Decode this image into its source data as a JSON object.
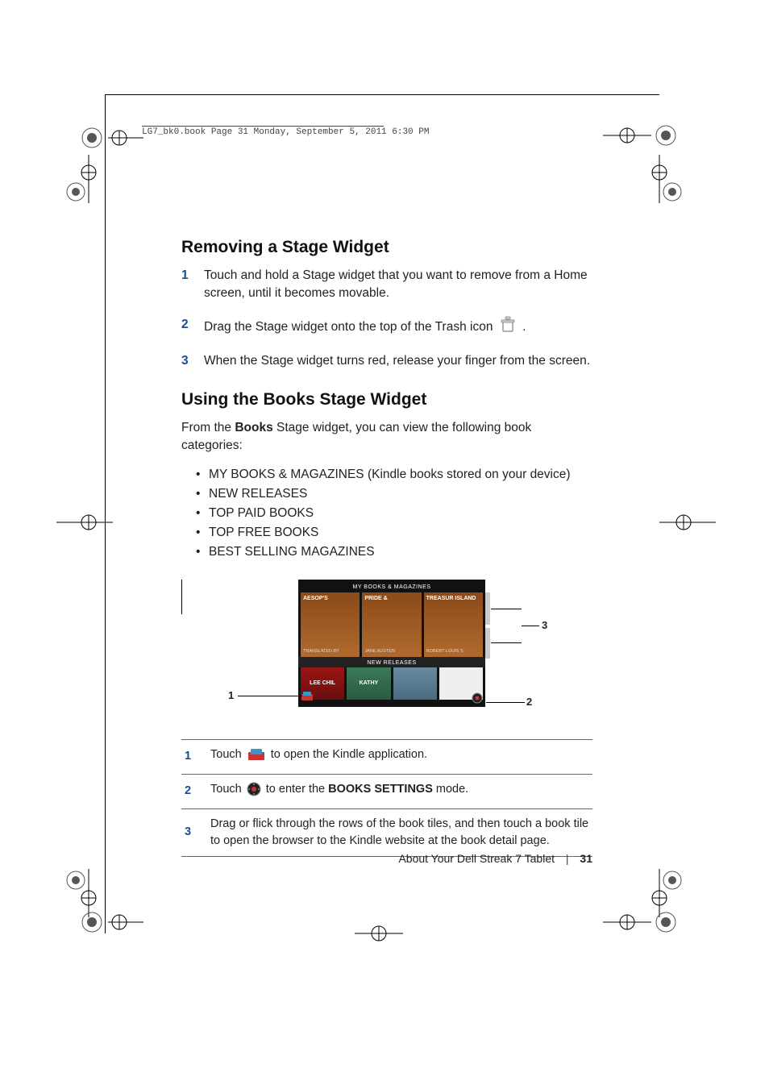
{
  "printHeader": "LG7_bk0.book  Page 31  Monday, September 5, 2011  6:30 PM",
  "section1": {
    "heading": "Removing a Stage Widget",
    "steps": [
      {
        "num": "1",
        "text": "Touch and hold a Stage widget that you want to remove from a Home screen, until it becomes movable."
      },
      {
        "num": "2",
        "textBefore": "Drag the Stage widget onto the top of the Trash icon ",
        "textAfter": " ."
      },
      {
        "num": "3",
        "text": "When the Stage widget turns red, release your finger from the screen."
      }
    ]
  },
  "section2": {
    "heading": "Using the Books Stage Widget",
    "introBefore": "From the ",
    "introBold": "Books",
    "introAfter": " Stage widget, you can view the following book categories:",
    "bullets": [
      "MY BOOKS & MAGAZINES (Kindle books stored on your device)",
      "NEW RELEASES",
      "TOP PAID BOOKS",
      "TOP FREE BOOKS",
      "BEST SELLING MAGAZINES"
    ]
  },
  "widget": {
    "header1": "MY BOOKS & MAGAZINES",
    "row1": [
      {
        "title": "AESOP'S",
        "author": "TRANSLATED BY"
      },
      {
        "title": "PRIDE &",
        "author": "JANE AUSTEN"
      },
      {
        "title": "TREASUR ISLAND",
        "author": "ROBERT LOUIS S"
      }
    ],
    "header2": "NEW RELEASES",
    "row2": [
      "LEE CHIL",
      "KATHY",
      "",
      ""
    ]
  },
  "callouts": {
    "c1": "1",
    "c2": "2",
    "c3": "3"
  },
  "reftable": [
    {
      "num": "1",
      "before": "Touch ",
      "after": " to open the Kindle application."
    },
    {
      "num": "2",
      "before": "Touch ",
      "mid": " to enter the ",
      "bold": "BOOKS SETTINGS",
      "after": " mode."
    },
    {
      "num": "3",
      "text": "Drag or flick through the rows of the book tiles, and then touch a book tile to open the browser to the Kindle website at the book detail page."
    }
  ],
  "footer": {
    "chapter": "About Your Dell Streak 7 Tablet",
    "page": "31"
  }
}
